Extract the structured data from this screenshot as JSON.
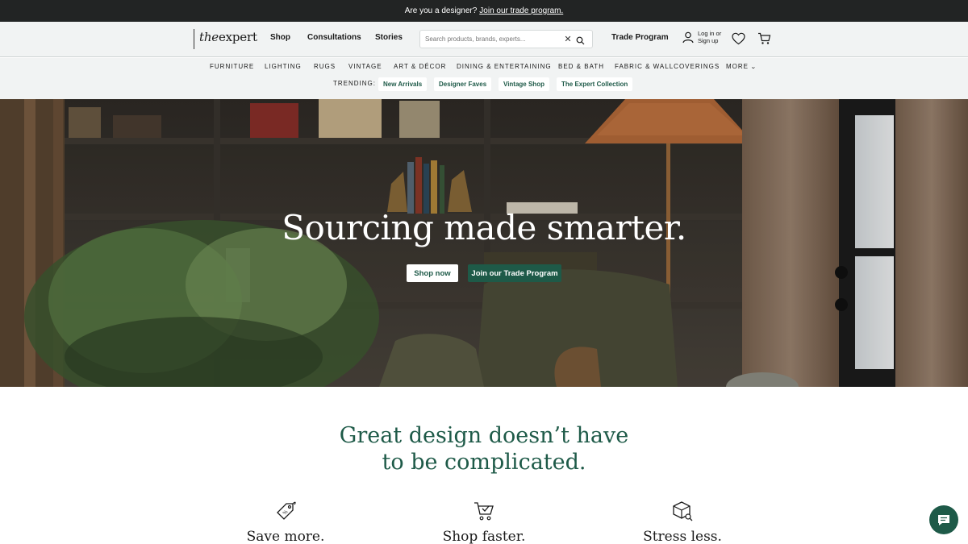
{
  "announcement": {
    "text": "Are you a designer?",
    "link": "Join our trade program."
  },
  "header": {
    "logo_the": "the",
    "logo_expert": "expert",
    "nav": [
      "Shop",
      "Consultations",
      "Stories"
    ],
    "search_placeholder": "Search products, brands, experts...",
    "trade_program": "Trade Program",
    "login_line1": "Log in or",
    "login_line2": "Sign up"
  },
  "categories": [
    "FURNITURE",
    "LIGHTING",
    "RUGS",
    "VINTAGE",
    "ART & DÉCOR",
    "DINING & ENTERTAINING",
    "BED & BATH",
    "FABRIC & WALLCOVERINGS",
    "MORE"
  ],
  "trending": {
    "label": "TRENDING:",
    "chips": [
      "New Arrivals",
      "Designer Faves",
      "Vintage Shop",
      "The Expert Collection"
    ]
  },
  "hero": {
    "title": "Sourcing made smarter.",
    "shop_now": "Shop now",
    "join_trade": "Join our Trade Program"
  },
  "value_props": {
    "headline_line1": "Great design doesn’t have",
    "headline_line2": "to be complicated.",
    "items": [
      {
        "label": "Save more.",
        "icon": "price-tag-icon"
      },
      {
        "label": "Shop faster.",
        "icon": "cart-check-icon"
      },
      {
        "label": "Stress less.",
        "icon": "box-search-icon"
      }
    ]
  },
  "colors": {
    "brand_green": "#1e5a48",
    "announcement_bg": "#222424",
    "header_bg": "#f1f3f3"
  }
}
